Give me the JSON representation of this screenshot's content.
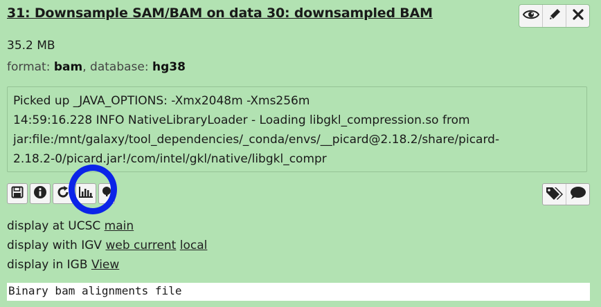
{
  "dataset": {
    "title": "31: Downsample SAM/BAM on data 30: downsampled BAM",
    "size": "35.2 MB",
    "format_label": "format:",
    "format_value": "bam",
    "database_label": ", database:",
    "database_value": "hg38"
  },
  "top_actions": [
    "eye-icon",
    "pencil-icon",
    "close-icon"
  ],
  "peek_lines": [
    "Picked up _JAVA_OPTIONS: -Xmx2048m -Xms256m",
    "14:59:16.228 INFO NativeLibraryLoader - Loading libgkl_compression.so from",
    "jar:file:/mnt/galaxy/tool_dependencies/_conda/envs/__picard@2.18.2/share/picard-",
    "2.18.2-0/picard.jar!/com/intel/gkl/native/libgkl_compr"
  ],
  "actions_left": [
    "save-icon",
    "info-icon",
    "rerun-icon",
    "visualize-icon",
    "help-icon"
  ],
  "actions_right": [
    "tags-icon",
    "comment-icon"
  ],
  "displays": {
    "ucsc_label": "display at UCSC",
    "ucsc_main": "main",
    "igv_label": "display with IGV",
    "igv_web_current": "web current",
    "igv_local": "local",
    "igb_label": "display in IGB",
    "igb_view": "View"
  },
  "info_text": "Binary bam alignments file",
  "highlight_color": "#0b24e8"
}
